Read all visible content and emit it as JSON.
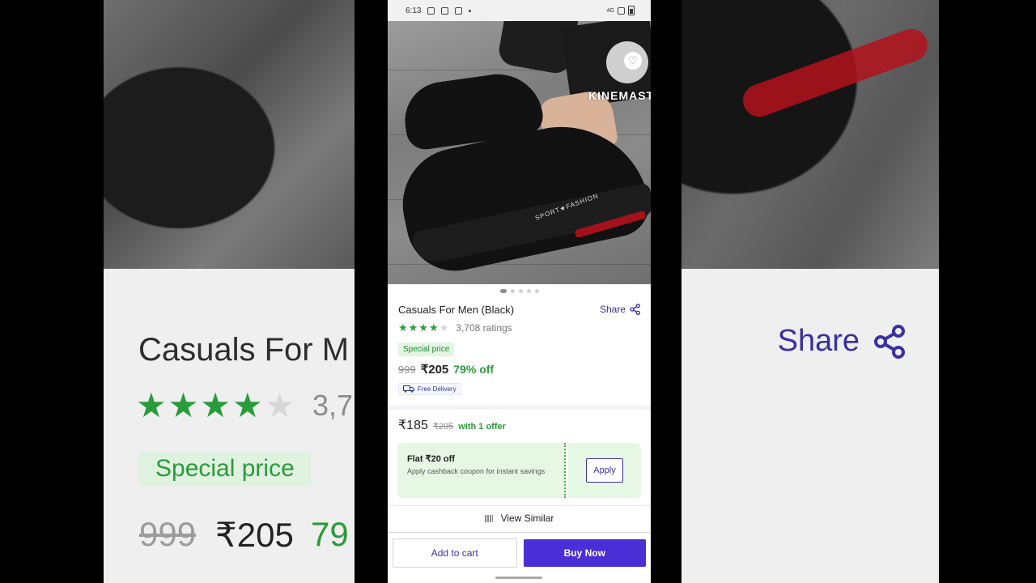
{
  "status_bar": {
    "time": "6:13",
    "network": "4G"
  },
  "watermark": {
    "text": "KINEMASTER"
  },
  "product": {
    "title": "Casuals For Men (Black)",
    "share_label": "Share",
    "rating_stars": "★★★★",
    "rating_stars_empty": "★",
    "rating_value": 3.5,
    "ratings_count": "3,708 ratings",
    "special_label": "Special price",
    "mrp": "999",
    "price": "₹205",
    "discount": "79% off",
    "delivery": "Free Delivery",
    "image_text": "SPORT★FASHION",
    "image_pages": 5,
    "image_current_page": 1
  },
  "offer": {
    "price": "₹185",
    "strike_price": "₹205",
    "text": "with 1 offer",
    "coupon_title": "Flat ₹20 off",
    "coupon_desc": "Apply cashback coupon for instant savings",
    "apply_label": "Apply"
  },
  "view_similar": "View Similar",
  "actions": {
    "add_to_cart": "Add to cart",
    "buy_now": "Buy Now"
  },
  "background_zoom": {
    "title": "Casuals For M",
    "ratings": "3,7",
    "special": "Special price",
    "mrp": "999",
    "price": "₹205",
    "discount": "79",
    "share": "Share"
  },
  "colors": {
    "accent": "#3b2fa3",
    "buy_button": "#4a2fd6",
    "green": "#2a9b3a"
  }
}
